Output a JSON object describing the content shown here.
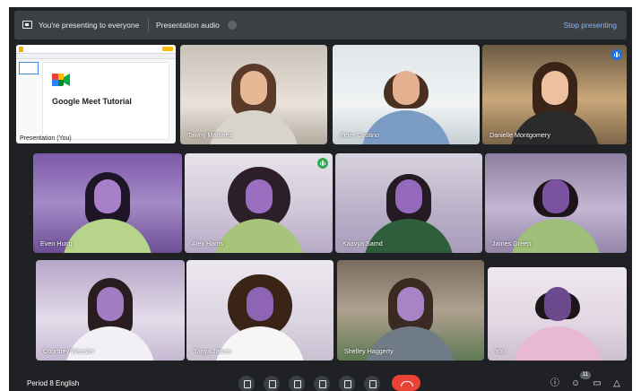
{
  "banner": {
    "presenting_text": "You're presenting to everyone",
    "audio_label": "Presentation audio",
    "stop_label": "Stop presenting"
  },
  "presentation_tile": {
    "slide_title": "Google Meet Tutorial",
    "name": "Presentation (You)"
  },
  "participants": [
    {
      "name": "Tawny Martinez",
      "speaking": false
    },
    {
      "name": "Peter Coutino",
      "speaking": false
    },
    {
      "name": "Danielle Montgomery",
      "speaking": true,
      "indicator_color": "#1a73e8"
    },
    {
      "name": "Even Hung",
      "speaking": false
    },
    {
      "name": "Alex Harris",
      "speaking": true,
      "indicator_color": "#34a853"
    },
    {
      "name": "Kaavya Samd",
      "speaking": false
    },
    {
      "name": "James Green",
      "speaking": false
    },
    {
      "name": "Courtney Weesler",
      "speaking": false
    },
    {
      "name": "Tanya James",
      "speaking": false
    },
    {
      "name": "Shelley Haggerty",
      "speaking": false
    },
    {
      "name": "You",
      "speaking": false
    }
  ],
  "controls": {
    "meeting_title": "Period 8 English",
    "participant_count": "11",
    "end_call_color": "#ea4335"
  },
  "icons": [
    "present-to-all-icon",
    "toggle-icon",
    "microphone-icon",
    "camera-icon",
    "captions-icon",
    "raise-hand-icon",
    "present-icon",
    "more-options-icon",
    "end-call-icon",
    "info-icon",
    "people-icon",
    "chat-icon",
    "activities-icon"
  ]
}
